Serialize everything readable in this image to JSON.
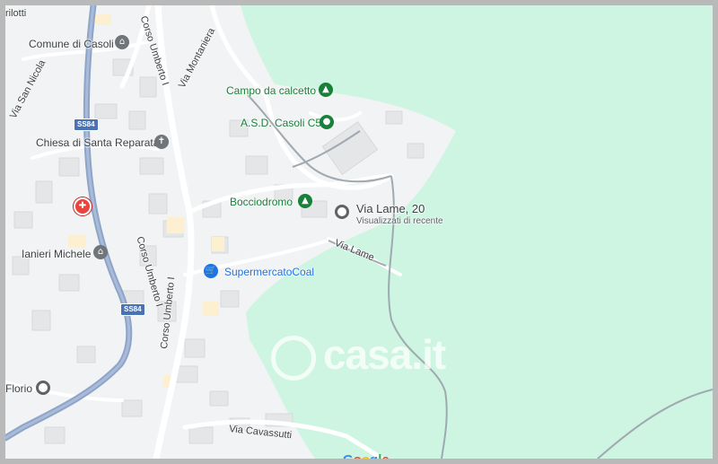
{
  "map": {
    "colors": {
      "land": "#f1f3f4",
      "park": "#cdf5e1",
      "road": "#ffffff",
      "highway": "#8ea5c9",
      "building": "#e4e6e8"
    },
    "places": {
      "campo": "Campo da calcetto",
      "asd": "A.S.D. Casoli C5",
      "bocciodromo": "Bocciodromo",
      "comune": "Comune di Casoli",
      "chiesa": "Chiesa di Santa Reparata",
      "ianieri": "Ianieri Michele",
      "supermercato": "SupermercatoCoal",
      "florio": "Florio"
    },
    "selected": {
      "title": "Via Lame, 20",
      "subtitle": "Visualizzati di recente"
    },
    "roads": {
      "umberto_top": "Corso Umberto I",
      "umberto_mid": "Corso Umberto I",
      "umberto_bottom": "Corso Umberto I",
      "montaniera": "Via Montaniera",
      "san_nicola": "Via San Nicola",
      "lame": "Via Lame",
      "cavassutti": "Via Cavassutti",
      "rilotti": "rilotti",
      "ss84_top": "SS84",
      "ss84_bottom": "SS84"
    },
    "icons": {
      "park": "tree-icon",
      "sports": "sports-icon",
      "church": "cross-icon",
      "city_hall": "building-icon",
      "shop": "cart-icon",
      "hospital": "hospital-icon"
    },
    "watermark": "casa.it",
    "attribution": "Google"
  }
}
